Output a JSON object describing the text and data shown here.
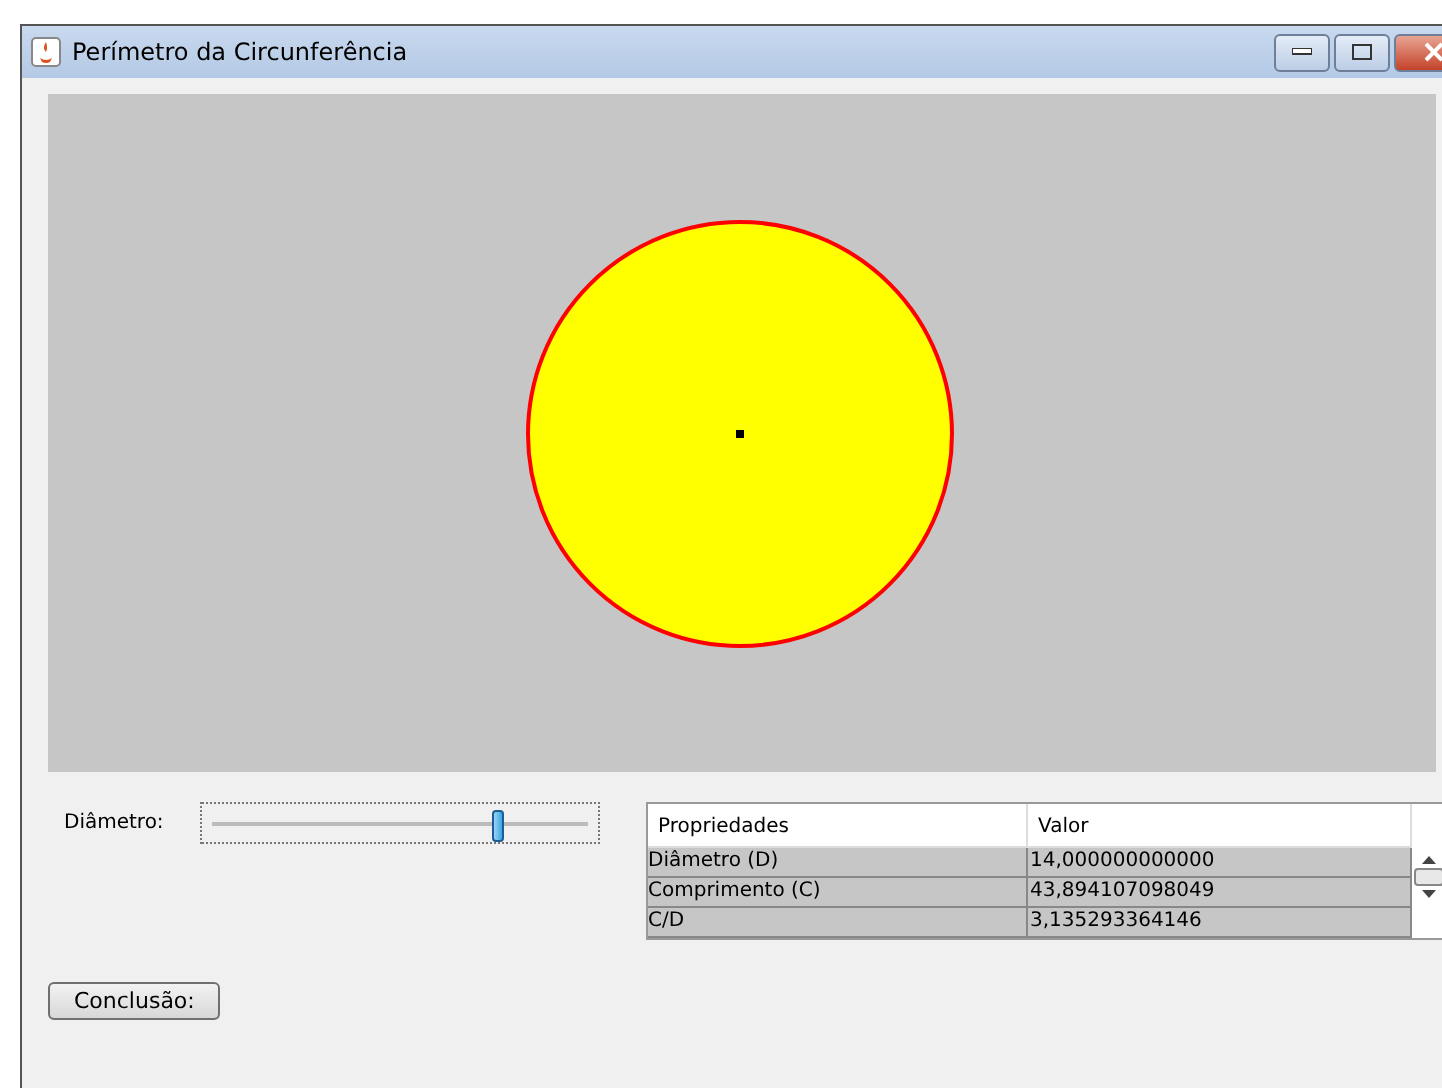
{
  "window": {
    "title": "Perímetro da Circunferência"
  },
  "slider": {
    "label": "Diâmetro:",
    "level": 0.76
  },
  "table": {
    "columns": [
      "Propriedades",
      "Valor"
    ],
    "rows": [
      {
        "cells": [
          "Diâmetro (D)",
          "14,000000000000"
        ]
      },
      {
        "cells": [
          "Comprimento (C)",
          "43,894107098049"
        ]
      },
      {
        "cells": [
          "C/D",
          "3,135293364146"
        ]
      }
    ]
  },
  "buttons": [
    "Conclusão:"
  ]
}
